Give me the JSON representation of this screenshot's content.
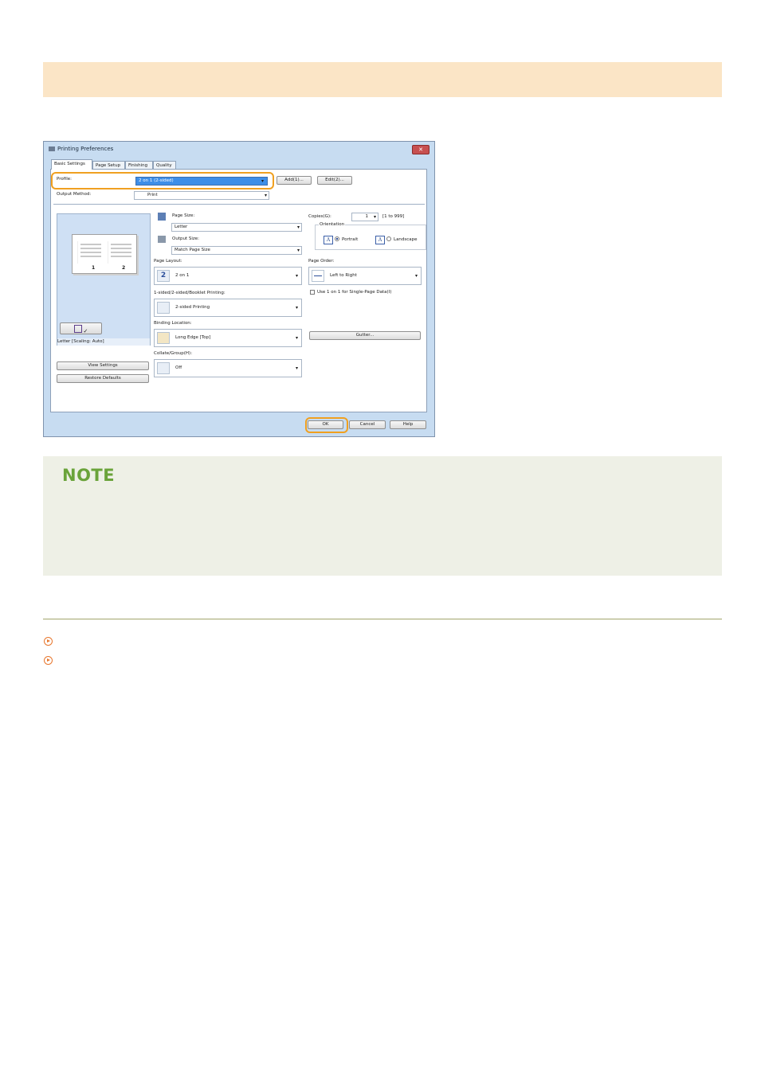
{
  "section": {
    "note_title": "NOTE"
  },
  "dialog": {
    "title": "Printing Preferences",
    "close_glyph": "✕",
    "tabs": [
      "Basic Settings",
      "Page Setup",
      "Finishing",
      "Quality"
    ],
    "profile": {
      "label": "Profile:",
      "value": "2 on 1 (2-sided)",
      "add_button": "Add(1)...",
      "edit_button": "Edit(2)..."
    },
    "output_method": {
      "label": "Output Method:",
      "value": "Print"
    },
    "preview": {
      "page_numbers": [
        "1",
        "2"
      ],
      "status": "Letter [Scaling: Auto]",
      "view_settings_button": "View Settings",
      "restore_defaults_button": "Restore Defaults"
    },
    "page_size": {
      "label": "Page Size:",
      "value": "Letter"
    },
    "output_size": {
      "label": "Output Size:",
      "value": "Match Page Size"
    },
    "page_layout": {
      "label": "Page Layout:",
      "value": "2 on 1",
      "icon_number": "2"
    },
    "sided": {
      "label": "1-sided/2-sided/Booklet Printing:",
      "value": "2-sided Printing"
    },
    "binding": {
      "label": "Binding Location:",
      "value": "Long Edge [Top]"
    },
    "collate": {
      "label": "Collate/Group(H):",
      "value": "Off"
    },
    "copies": {
      "label": "Copies(G):",
      "value": "1",
      "range": "[1 to 999]"
    },
    "orientation": {
      "legend": "Orientation",
      "portrait": "Portrait",
      "landscape": "Landscape",
      "icon_letter": "A",
      "selected": "Portrait"
    },
    "page_order": {
      "label": "Page Order:",
      "value": "Left to Right"
    },
    "single_page_checkbox": "Use 1 on 1 for Single-Page Data(I)",
    "gutter_button": "Gutter...",
    "ok_button": "OK",
    "cancel_button": "Cancel",
    "help_button": "Help"
  },
  "colors": {
    "highlight": "#f0a020",
    "note_title": "#6aa33a",
    "link_icon": "#e8772e"
  }
}
